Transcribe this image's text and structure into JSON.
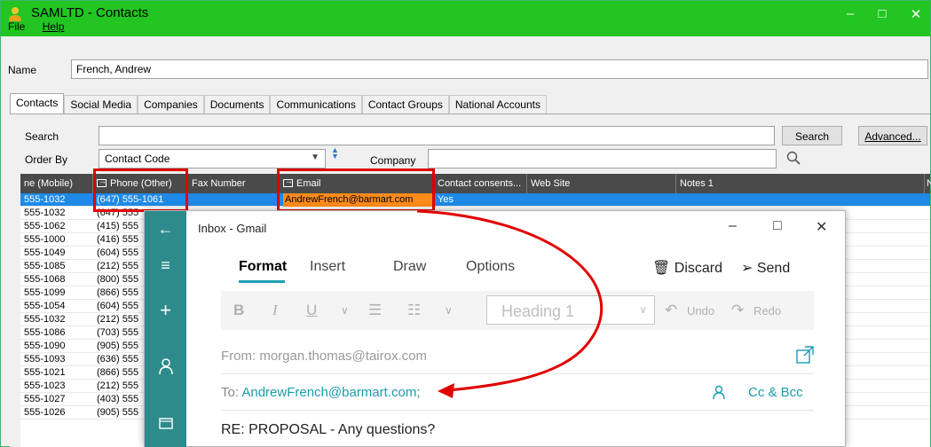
{
  "window": {
    "title": "SAMLTD - Contacts",
    "minimize": "–",
    "maximize": "□",
    "close": "✕"
  },
  "menu": {
    "file": "File",
    "help": "Help"
  },
  "name_row": {
    "label": "Name",
    "value": "French, Andrew"
  },
  "tabs": [
    "Contacts",
    "Social Media",
    "Companies",
    "Documents",
    "Communications",
    "Contact Groups",
    "National Accounts"
  ],
  "search": {
    "label": "Search",
    "button": "Search",
    "advanced": "Advanced..."
  },
  "order_by": {
    "label": "Order By",
    "value": "Contact Code",
    "company_label": "Company"
  },
  "grid": {
    "columns": [
      "ne (Mobile)",
      "Phone (Other)",
      "Fax Number",
      "Email",
      "Contact consents...",
      "Web Site",
      "Notes 1",
      "No"
    ],
    "selected_row": {
      "mobile": "555-1032",
      "phone_other": "(647) 555-1061",
      "email": "AndrewFrench@barmart.com",
      "consent": "Yes"
    },
    "rows": [
      {
        "mobile": "555-1032",
        "phone": "(647) 555"
      },
      {
        "mobile": "555-1062",
        "phone": "(415) 555"
      },
      {
        "mobile": "555-1000",
        "phone": "(416) 555"
      },
      {
        "mobile": "555-1049",
        "phone": "(604) 555"
      },
      {
        "mobile": "555-1085",
        "phone": "(212) 555"
      },
      {
        "mobile": "555-1068",
        "phone": "(800) 555"
      },
      {
        "mobile": "555-1099",
        "phone": "(866) 555"
      },
      {
        "mobile": "555-1054",
        "phone": "(604) 555"
      },
      {
        "mobile": "555-1032",
        "phone": "(212) 555"
      },
      {
        "mobile": "555-1086",
        "phone": "(703) 555"
      },
      {
        "mobile": "555-1090",
        "phone": "(905) 555"
      },
      {
        "mobile": "555-1093",
        "phone": "(636) 555"
      },
      {
        "mobile": "555-1021",
        "phone": "(866) 555"
      },
      {
        "mobile": "555-1023",
        "phone": "(212) 555"
      },
      {
        "mobile": "555-1027",
        "phone": "(403) 555"
      },
      {
        "mobile": "555-1026",
        "phone": "(905) 555"
      }
    ]
  },
  "mail": {
    "title": "Inbox - Gmail",
    "tabs": [
      "Format",
      "Insert",
      "Draw",
      "Options"
    ],
    "discard": "Discard",
    "send": "Send",
    "toolbar": {
      "bold": "B",
      "italic": "I",
      "underline": "U",
      "heading": "Heading 1",
      "undo": "Undo",
      "redo": "Redo"
    },
    "from_label": "From:",
    "from_value": "morgan.thomas@tairox.com",
    "to_label": "To:",
    "to_value": "AndrewFrench@barmart.com;",
    "cc_bcc": "Cc & Bcc",
    "subject": "RE: PROPOSAL - Any questions?"
  },
  "colors": {
    "titlebar": "#22c522",
    "grid_header": "#4a4a4a",
    "selection": "#1e8ae6",
    "email_highlight": "#ff8c1a",
    "mail_sidebar": "#2e8b8b",
    "accent": "#1a9cb0",
    "callout": "#e00000"
  }
}
